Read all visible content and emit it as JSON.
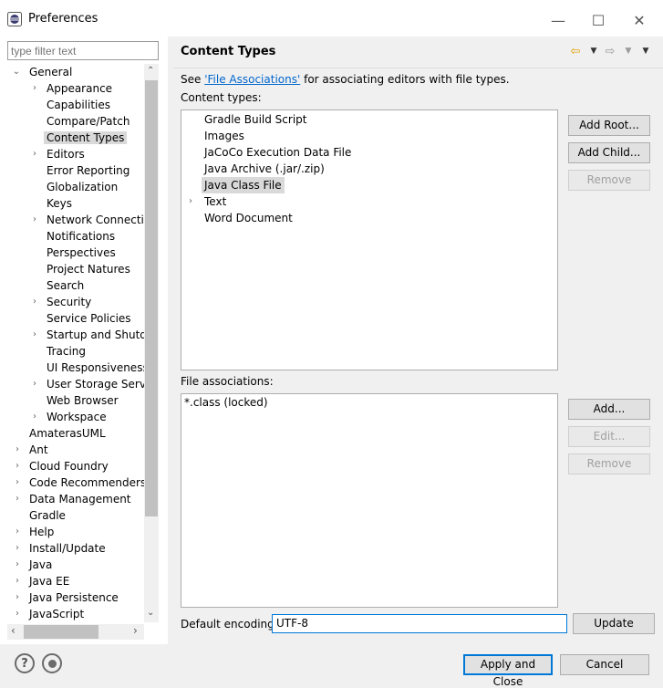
{
  "window": {
    "title": "Preferences",
    "minimize_glyph": "—",
    "maximize_glyph": "☐",
    "close_glyph": "✕"
  },
  "filter": {
    "placeholder": "type filter text"
  },
  "tree": {
    "items": [
      {
        "label": "General",
        "expanded": true
      },
      {
        "label": "Appearance"
      },
      {
        "label": "Capabilities"
      },
      {
        "label": "Compare/Patch"
      },
      {
        "label": "Content Types",
        "selected": true
      },
      {
        "label": "Editors"
      },
      {
        "label": "Error Reporting"
      },
      {
        "label": "Globalization"
      },
      {
        "label": "Keys"
      },
      {
        "label": "Network Connection"
      },
      {
        "label": "Notifications"
      },
      {
        "label": "Perspectives"
      },
      {
        "label": "Project Natures"
      },
      {
        "label": "Search"
      },
      {
        "label": "Security"
      },
      {
        "label": "Service Policies"
      },
      {
        "label": "Startup and Shutdo"
      },
      {
        "label": "Tracing"
      },
      {
        "label": "UI Responsiveness M"
      },
      {
        "label": "User Storage Service"
      },
      {
        "label": "Web Browser"
      },
      {
        "label": "Workspace"
      },
      {
        "label": "AmaterasUML"
      },
      {
        "label": "Ant"
      },
      {
        "label": "Cloud Foundry"
      },
      {
        "label": "Code Recommenders"
      },
      {
        "label": "Data Management"
      },
      {
        "label": "Gradle"
      },
      {
        "label": "Help"
      },
      {
        "label": "Install/Update"
      },
      {
        "label": "Java"
      },
      {
        "label": "Java EE"
      },
      {
        "label": "Java Persistence"
      },
      {
        "label": "JavaScript"
      }
    ]
  },
  "page": {
    "title": "Content Types",
    "intro_prefix": "See ",
    "intro_link": "'File Associations'",
    "intro_suffix": " for associating editors with file types.",
    "content_types_label": "Content types:",
    "content_types": [
      {
        "label": "Gradle Build Script"
      },
      {
        "label": "Images"
      },
      {
        "label": "JaCoCo Execution Data File"
      },
      {
        "label": "Java Archive (.jar/.zip)"
      },
      {
        "label": "Java Class File",
        "selected": true
      },
      {
        "label": "Text",
        "expandable": true
      },
      {
        "label": "Word Document"
      }
    ],
    "content_buttons": {
      "add_root": "Add Root...",
      "add_child": "Add Child...",
      "remove": "Remove"
    },
    "file_assoc_label": "File associations:",
    "file_assocs": [
      "*.class (locked)"
    ],
    "file_buttons": {
      "add": "Add...",
      "edit": "Edit...",
      "remove": "Remove"
    },
    "encoding_label": "Default encoding:",
    "encoding_value": "UTF-8",
    "update_label": "Update"
  },
  "footer": {
    "help_glyph": "?",
    "apply_close": "Apply and Close",
    "cancel": "Cancel"
  },
  "colors": {
    "accent": "#0078d7",
    "selection": "#d9d9d9",
    "back_arrow": "#e0a000",
    "link": "#0066cc"
  }
}
